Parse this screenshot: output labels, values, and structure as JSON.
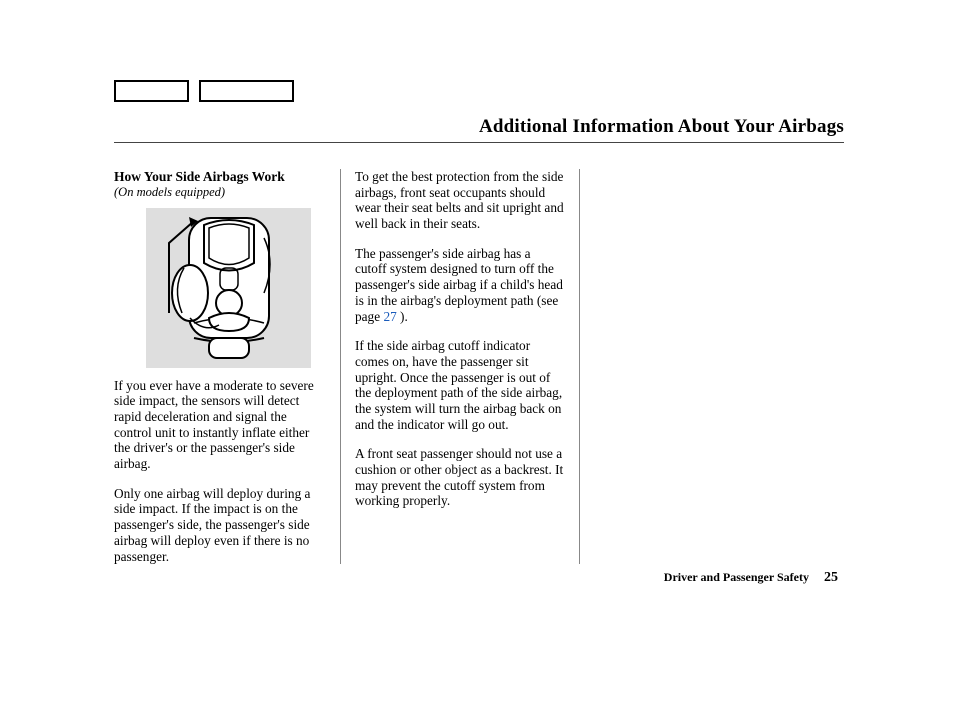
{
  "title": "Additional Information About Your Airbags",
  "section": {
    "heading": "How Your Side Airbags Work",
    "note": "(On models equipped)"
  },
  "col1": {
    "p1": "If you ever have a moderate to severe side impact, the sensors will detect rapid deceleration and signal the control unit to instantly inflate either the driver's or the passenger's side airbag.",
    "p2": "Only one airbag will deploy during a side impact. If the impact is on the passenger's side, the passenger's side airbag will deploy even if there is no passenger."
  },
  "col2": {
    "p1": "To get the best protection from the side airbags, front seat occupants should wear their seat belts and sit upright and well back in their seats.",
    "p2a": "The passenger's side airbag has a cutoff system designed to turn off the passenger's side airbag if a child's head is in the airbag's deployment path (see page ",
    "p2link": "27",
    "p2b": " ).",
    "p3": "If the side airbag cutoff indicator comes on, have the passenger sit upright. Once the passenger is out of the deployment path of the side airbag, the system will turn the airbag back on and the indicator will go out.",
    "p4": "A front seat passenger should not use a cushion or other object as a backrest. It may prevent the cutoff system from working properly."
  },
  "footer": {
    "section_label": "Driver and Passenger Safety",
    "page_number": "25"
  }
}
